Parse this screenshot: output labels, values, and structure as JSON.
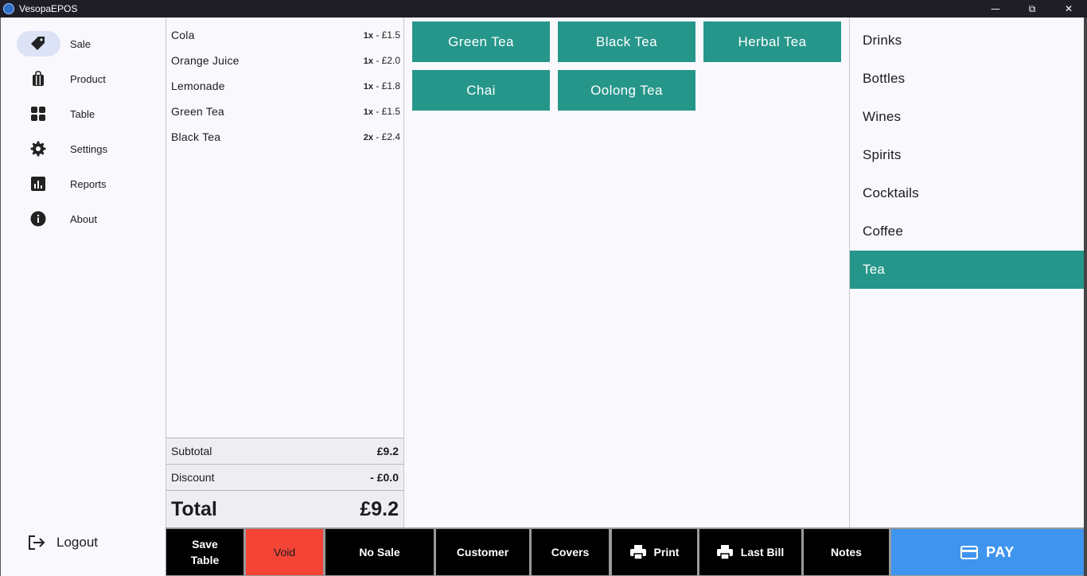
{
  "window": {
    "title": "VesopaEPOS",
    "icon": "vesopa-logo-icon",
    "controls": [
      "minimize-icon",
      "restore-icon",
      "close-icon"
    ]
  },
  "sidebar": {
    "items": [
      {
        "label": "Sale",
        "icon": "tag-icon",
        "active": true
      },
      {
        "label": "Product",
        "icon": "shopping-bag-icon",
        "active": false
      },
      {
        "label": "Table",
        "icon": "grid-icon",
        "active": false
      },
      {
        "label": "Settings",
        "icon": "gear-icon",
        "active": false
      },
      {
        "label": "Reports",
        "icon": "bar-chart-icon",
        "active": false
      },
      {
        "label": "About",
        "icon": "info-icon",
        "active": false
      }
    ],
    "logout_label": "Logout"
  },
  "order": {
    "lines": [
      {
        "name": "Cola",
        "qty": "1x",
        "price": "- £1.5"
      },
      {
        "name": "Orange Juice",
        "qty": "1x",
        "price": "- £2.0"
      },
      {
        "name": "Lemonade",
        "qty": "1x",
        "price": "- £1.8"
      },
      {
        "name": "Green Tea",
        "qty": "1x",
        "price": "- £1.5"
      },
      {
        "name": "Black Tea",
        "qty": "2x",
        "price": "- £2.4"
      }
    ],
    "subtotal_label": "Subtotal",
    "subtotal_value": "£9.2",
    "discount_label": "Discount",
    "discount_value": "- £0.0",
    "total_label": "Total",
    "total_value": "£9.2"
  },
  "products": [
    "Green Tea",
    "Black Tea",
    "Herbal Tea",
    "Chai",
    "Oolong Tea"
  ],
  "categories": {
    "items": [
      "Drinks",
      "Bottles",
      "Wines",
      "Spirits",
      "Cocktails",
      "Coffee",
      "Tea"
    ],
    "selected": "Tea"
  },
  "actions": {
    "save_table_line1": "Save",
    "save_table_line2": "Table",
    "void": "Void",
    "no_sale": "No Sale",
    "customer": "Customer",
    "covers": "Covers",
    "print": "Print",
    "last_bill": "Last Bill",
    "notes": "Notes",
    "pay": "PAY"
  },
  "colors": {
    "accent": "#26968a",
    "pay": "#3f95ee",
    "void": "#f44436",
    "active_nav": "#dde3f6"
  }
}
